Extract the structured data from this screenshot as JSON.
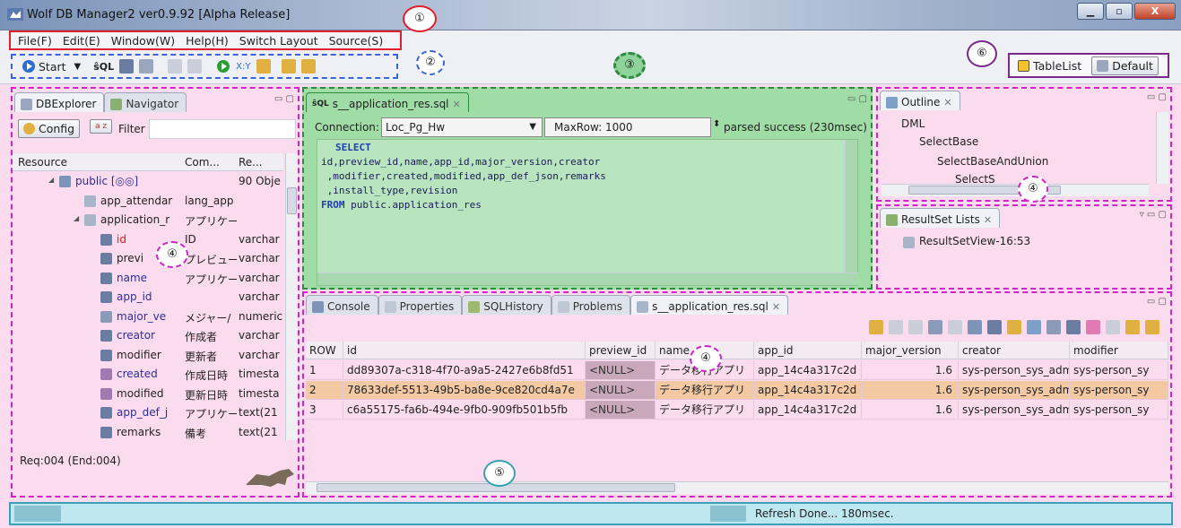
{
  "window": {
    "title": "Wolf DB Manager2 ver0.9.92 [Alpha Release]",
    "min_label": "▁",
    "max_label": "▫",
    "close_label": "X"
  },
  "menu": [
    "File(F)",
    "Edit(E)",
    "Window(W)",
    "Help(H)",
    "Switch Layout",
    "Source(S)"
  ],
  "toolbar": {
    "start_label": "Start"
  },
  "callouts": {
    "c1": "①",
    "c2": "②",
    "c3": "③",
    "c4": "④",
    "c5": "⑤",
    "c6": "⑥"
  },
  "layout": {
    "tablelist_label": "TableList",
    "default_label": "Default"
  },
  "explorer": {
    "tabs": [
      "DBExplorer",
      "Navigator"
    ],
    "config_label": "Config",
    "sort_label": "a z",
    "filter_label": "Filter",
    "columns": [
      "Resource",
      "Com...",
      "Re..."
    ],
    "rows": [
      {
        "name": "public [◎◎]",
        "com": "",
        "re": "90 Obje",
        "indent": 1,
        "icon": "schema",
        "color": "#2d2d9a"
      },
      {
        "name": "app_attendar",
        "com": "lang_app",
        "re": "",
        "indent": 2,
        "icon": "table",
        "color": "#222"
      },
      {
        "name": "application_r",
        "com": "アプリケー",
        "re": "",
        "indent": 2,
        "icon": "table",
        "color": "#222"
      },
      {
        "name": "id",
        "com": "ID",
        "re": "varchar",
        "indent": 3,
        "icon": "abl",
        "color": "#e01b1b"
      },
      {
        "name": "previ",
        "com": "プレビュー",
        "re": "varchar",
        "indent": 3,
        "icon": "abl",
        "color": "#222"
      },
      {
        "name": "name",
        "com": "アプリケー",
        "re": "varchar",
        "indent": 3,
        "icon": "abl",
        "color": "#2d2d9a"
      },
      {
        "name": "app_id",
        "com": "",
        "re": "varchar",
        "indent": 3,
        "icon": "abl",
        "color": "#2d2d9a"
      },
      {
        "name": "major_ve",
        "com": "メジャー/",
        "re": "numeric",
        "indent": 3,
        "icon": "num",
        "color": "#2d2d9a"
      },
      {
        "name": "creator",
        "com": "作成者",
        "re": "varchar",
        "indent": 3,
        "icon": "abl",
        "color": "#2d2d9a"
      },
      {
        "name": "modifier",
        "com": "更新者",
        "re": "varchar",
        "indent": 3,
        "icon": "abl",
        "color": "#222"
      },
      {
        "name": "created",
        "com": "作成日時",
        "re": "timesta",
        "indent": 3,
        "icon": "time",
        "color": "#2d2d9a"
      },
      {
        "name": "modified",
        "com": "更新日時",
        "re": "timesta",
        "indent": 3,
        "icon": "time",
        "color": "#222"
      },
      {
        "name": "app_def_j",
        "com": "アプリケー",
        "re": "text(21",
        "indent": 3,
        "icon": "abl",
        "color": "#2d2d9a"
      },
      {
        "name": "remarks",
        "com": "備考",
        "re": "text(21",
        "indent": 3,
        "icon": "abl",
        "color": "#222"
      }
    ],
    "status": "Req:004 (End:004)"
  },
  "editor": {
    "tab_label": "s__application_res.sql",
    "connection_label": "Connection:",
    "connection_value": "Loc_Pg_Hw",
    "maxrow_label": "MaxRow: 1000",
    "parse_status": "parsed success (230msec)",
    "sql_lines": [
      "SELECT",
      "id,preview_id,name,app_id,major_version,creator",
      " ,modifier,created,modified,app_def_json,remarks",
      " ,install_type,revision",
      "FROM public.application_res"
    ]
  },
  "outline": {
    "tab_label": "Outline",
    "items": [
      "DML",
      "SelectBase",
      "SelectBaseAndUnion",
      "SelectS"
    ]
  },
  "resultset_lists": {
    "tab_label": "ResultSet Lists",
    "items": [
      "ResultSetView-16:53"
    ]
  },
  "bottom": {
    "tabs": [
      "Console",
      "Properties",
      "SQLHistory",
      "Problems",
      "s__application_res.sql"
    ],
    "columns": [
      "ROW",
      "id",
      "preview_id",
      "name",
      "app_id",
      "major_version",
      "creator",
      "modifier"
    ],
    "rows": [
      [
        "1",
        "dd89307a-c318-4f70-a9a5-2427e6b8fd51",
        "<NULL>",
        "データ移行アプリ",
        "app_14c4a317c2d",
        "1.6",
        "sys-person_sys_admin",
        "sys-person_sy"
      ],
      [
        "2",
        "78633def-5513-49b5-ba8e-9ce820cd4a7e",
        "<NULL>",
        "データ移行アプリ",
        "app_14c4a317c2d",
        "1.6",
        "sys-person_sys_admin",
        "sys-person_sy"
      ],
      [
        "3",
        "c6a55175-fa6b-494e-9fb0-909fb501b5fb",
        "<NULL>",
        "データ移行アプリ",
        "app_14c4a317c2d",
        "1.6",
        "sys-person_sys_admin",
        "sys-person_sy"
      ]
    ]
  },
  "statusbar": {
    "text": "Refresh Done... 180msec."
  },
  "colors": {
    "accent_red": "#e0202a",
    "accent_blue": "#3a64d8",
    "accent_green": "#2f8a3e",
    "accent_magenta": "#d024c8",
    "accent_purple": "#7a2b8a"
  }
}
